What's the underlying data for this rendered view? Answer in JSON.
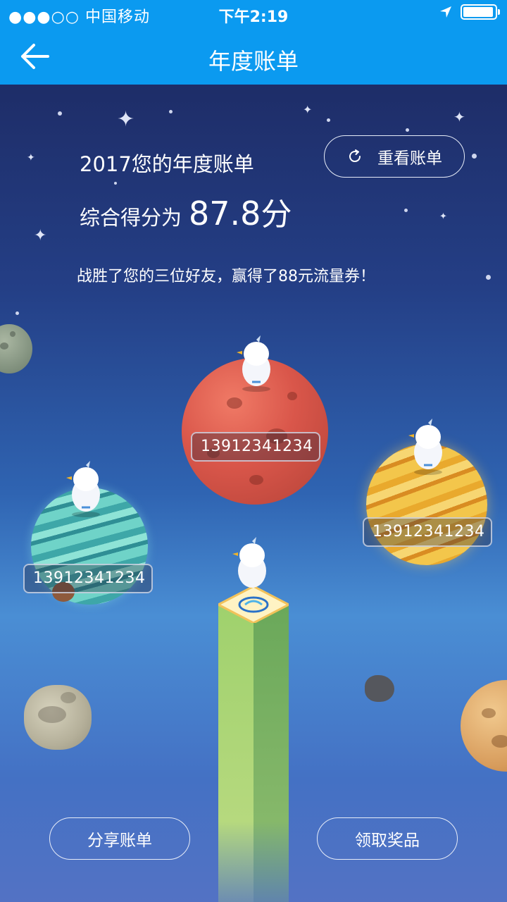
{
  "status_bar": {
    "carrier": "●●●○○ 中国移动",
    "time": "下午2:19"
  },
  "nav": {
    "title": "年度账单"
  },
  "report": {
    "title": "2017您的年度账单",
    "score_prefix": "综合得分为",
    "score_value": "87.8",
    "score_unit": "分",
    "result": "战胜了您的三位好友，赢得了88元流量券！"
  },
  "buttons": {
    "replay": "重看账单",
    "share": "分享账单",
    "claim_prize": "领取奖品"
  },
  "friends": [
    {
      "phone": "13912341234",
      "planet": "red"
    },
    {
      "phone": "13912341234",
      "planet": "gold"
    },
    {
      "phone": "13912341234",
      "planet": "teal"
    }
  ],
  "icons": [
    "back-arrow-icon",
    "wifi-icon",
    "location-arrow-icon",
    "battery-icon",
    "refresh-icon",
    "mascot-icon"
  ],
  "colors": {
    "nav_blue": "#0b9af0",
    "space_top": "#1e2d68",
    "space_bottom": "#4a8ed4"
  }
}
